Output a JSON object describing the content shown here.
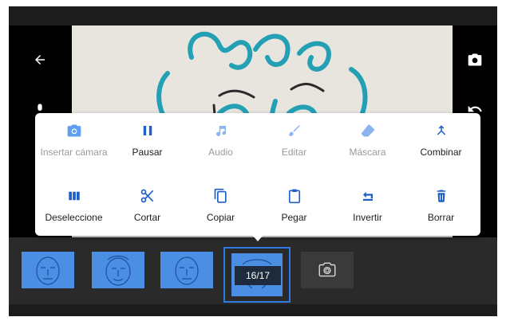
{
  "header": {
    "back_icon": "arrow-left-icon",
    "camera_icon": "camera-icon"
  },
  "side": {
    "mic_icon": "microphone-icon",
    "undo_icon": "undo-icon"
  },
  "menu": {
    "row1": [
      {
        "label": "Insertar cámara",
        "icon": "camera-icon",
        "enabled": false
      },
      {
        "label": "Pausar",
        "icon": "pause-icon",
        "enabled": true
      },
      {
        "label": "Audio",
        "icon": "music-note-icon",
        "enabled": false
      },
      {
        "label": "Editar",
        "icon": "brush-icon",
        "enabled": false
      },
      {
        "label": "Máscara",
        "icon": "eraser-icon",
        "enabled": false
      },
      {
        "label": "Combinar",
        "icon": "merge-icon",
        "enabled": true
      }
    ],
    "row2": [
      {
        "label": "Deseleccione",
        "icon": "deselect-icon",
        "enabled": true
      },
      {
        "label": "Cortar",
        "icon": "scissors-icon",
        "enabled": true
      },
      {
        "label": "Copiar",
        "icon": "copy-icon",
        "enabled": true
      },
      {
        "label": "Pegar",
        "icon": "clipboard-icon",
        "enabled": true
      },
      {
        "label": "Invertir",
        "icon": "reverse-icon",
        "enabled": true
      },
      {
        "label": "Borrar",
        "icon": "trash-icon",
        "enabled": true
      }
    ]
  },
  "timeline": {
    "frame_counter": "16/17",
    "add_frame_icon": "camera-icon"
  },
  "colors": {
    "accent": "#2f7ae6",
    "thumb": "#4a8fe4",
    "icon_active": "#1e5fc8",
    "icon_disabled": "#8cb3ee"
  }
}
